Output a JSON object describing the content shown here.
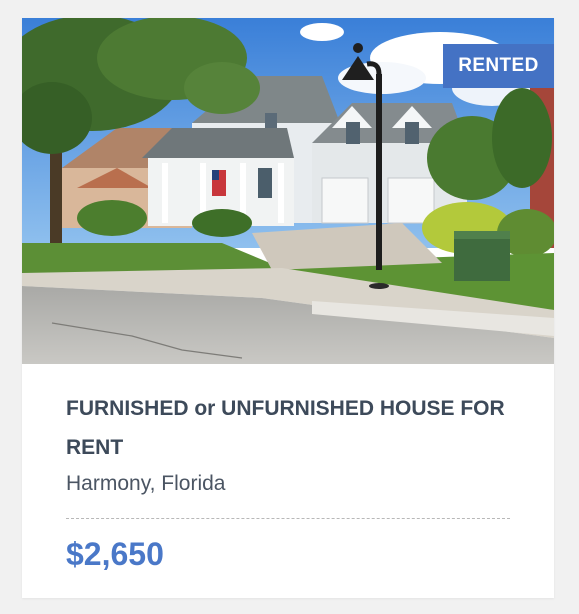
{
  "listing": {
    "status_badge": "RENTED",
    "title": "FURNISHED or UNFURNISHED HOUSE FOR RENT",
    "location": "Harmony, Florida",
    "price": "$2,650",
    "photo_icon": "house-photo"
  },
  "colors": {
    "badge_bg": "#4472c4",
    "price": "#4a78c8",
    "title": "#3d4a5a",
    "location": "#4b5563"
  }
}
